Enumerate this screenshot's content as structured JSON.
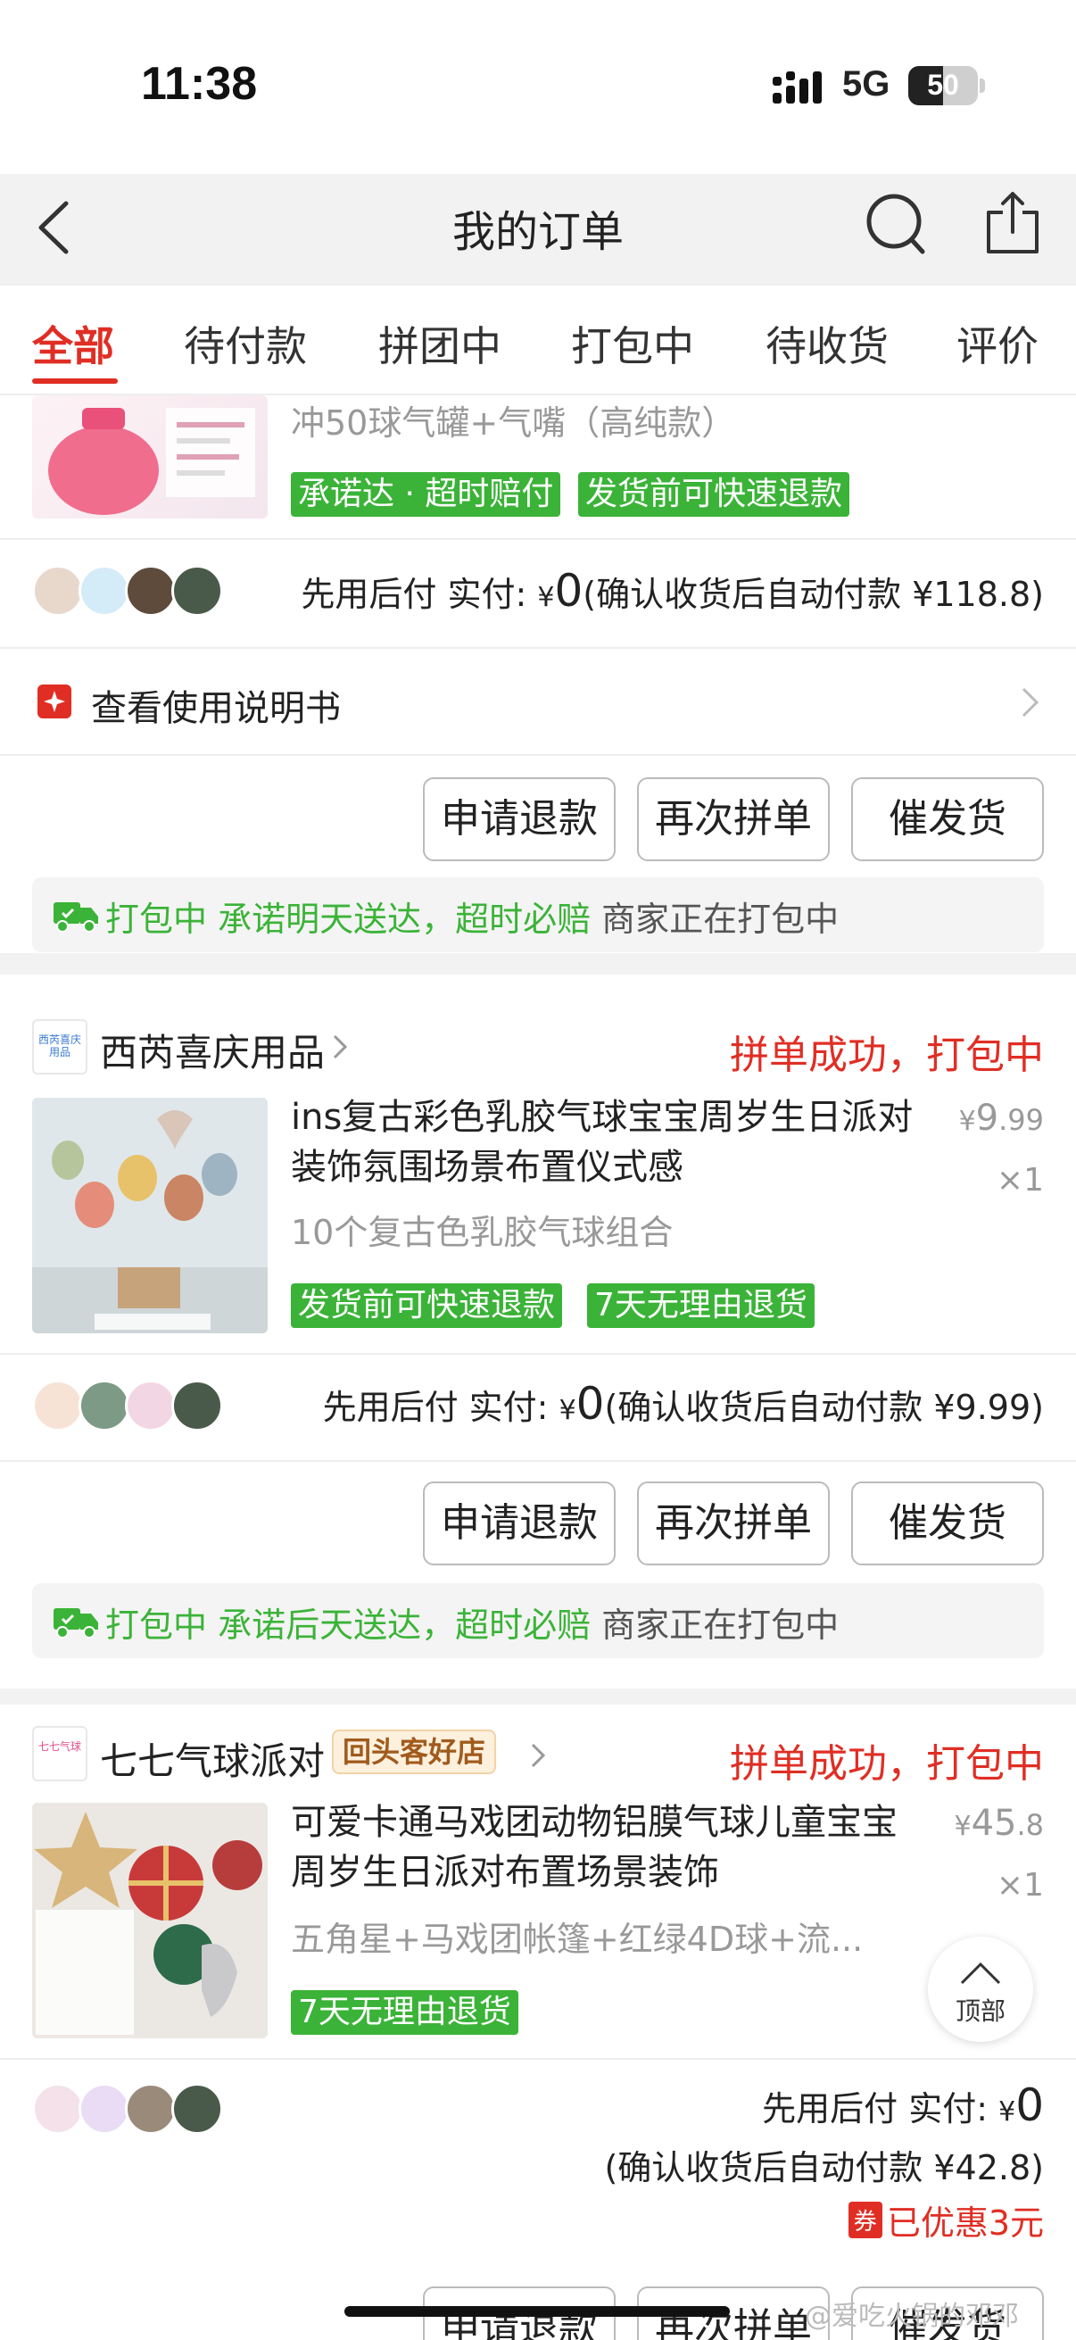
{
  "status_bar": {
    "time": "11:38",
    "network": "5G",
    "battery": "50",
    "battery_fraction": 0.5
  },
  "nav": {
    "title": "我的订单"
  },
  "tabs": [
    {
      "label": "全部",
      "active": true
    },
    {
      "label": "待付款"
    },
    {
      "label": "拼团中"
    },
    {
      "label": "打包中"
    },
    {
      "label": "待收货"
    },
    {
      "label": "评价"
    }
  ],
  "order1": {
    "subtitle": "冲50球气罐+气嘴（高纯款）",
    "tags": [
      "承诺达 · 超时赔付",
      "发货前可快速退款"
    ],
    "pay_prefix": "先用后付  实付: ",
    "pay_yen": "¥",
    "pay_zero": "0",
    "pay_auto": "(确认收货后自动付款 ¥118.8)",
    "manual_label": "查看使用说明书",
    "buttons": [
      "申请退款",
      "再次拼单",
      "催发货"
    ],
    "notice_green": "打包中  承诺明天送达，超时必赔",
    "notice_gray": " 商家正在打包中"
  },
  "order2": {
    "shop_logo_text": "西芮喜庆用品",
    "shop": "西芮喜庆用品",
    "status": "拼单成功，打包中",
    "title": "ins复古彩色乳胶气球宝宝周岁生日派对装饰氛围场景布置仪式感",
    "spec": "10个复古色乳胶气球组合",
    "price_yen": "¥",
    "price_int": "9",
    "price_dec": ".99",
    "qty": "×1",
    "tags": [
      "发货前可快速退款",
      "7天无理由退货"
    ],
    "pay_prefix": "先用后付  实付: ",
    "pay_yen": "¥",
    "pay_zero": "0",
    "pay_auto": "(确认收货后自动付款 ¥9.99)",
    "buttons": [
      "申请退款",
      "再次拼单",
      "催发货"
    ],
    "notice_green": "打包中  承诺后天送达，超时必赔",
    "notice_gray": " 商家正在打包中"
  },
  "order3": {
    "shop_logo_text": "七七气球",
    "shop": "七七气球派对",
    "shop_badge": "回头客好店",
    "status": "拼单成功，打包中",
    "title": "可爱卡通马戏团动物铝膜气球儿童宝宝周岁生日派对布置场景装饰",
    "spec": "五角星+马戏团帐篷+红绿4D球+流...",
    "price_yen": "¥",
    "price_int": "45",
    "price_dec": ".8",
    "qty": "×1",
    "tags": [
      "7天无理由退货"
    ],
    "pay_prefix": "先用后付  实付: ",
    "pay_yen": "¥",
    "pay_zero": "0",
    "pay_auto": "(确认收货后自动付款 ¥42.8)",
    "coupon_icon": "券",
    "coupon_text": "已优惠3元",
    "buttons": [
      "申请退款",
      "再次拼单",
      "催发货"
    ]
  },
  "back_to_top": "顶部",
  "watermark": "@爱吃火锅的邓邓"
}
